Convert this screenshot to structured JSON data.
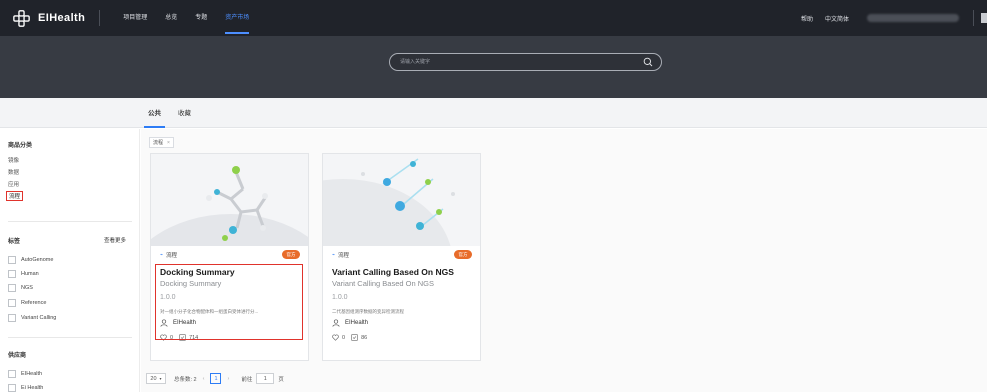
{
  "brand": {
    "name": "EIHealth"
  },
  "topnav": {
    "items": [
      {
        "label": "项目管理"
      },
      {
        "label": "总览"
      },
      {
        "label": "专题"
      },
      {
        "label": "资产市场",
        "active": true
      }
    ],
    "right": {
      "help": "帮助",
      "language": "中文简体"
    }
  },
  "search": {
    "placeholder": "请输入关键字",
    "icon": "search-icon"
  },
  "tabs": [
    {
      "label": "公共",
      "active": true
    },
    {
      "label": "收藏"
    }
  ],
  "sidebar": {
    "category_title": "商品分类",
    "categories": [
      {
        "label": "镜像"
      },
      {
        "label": "数据"
      },
      {
        "label": "应用"
      },
      {
        "label": "流程",
        "selected": true
      }
    ],
    "tags_title": "标签",
    "view_more": "查看更多",
    "tags": [
      "AutoGenome",
      "Human",
      "NGS",
      "Reference",
      "Variant Calling"
    ],
    "providers_title": "供应商",
    "providers": [
      "EIHealth",
      "Ei Health"
    ]
  },
  "filter": {
    "tag": "流程",
    "close": "×"
  },
  "cards": [
    {
      "type": "流程",
      "badge": "官方",
      "name": "Docking Summary",
      "subtitle": "Docking Summary",
      "version": "1.0.0",
      "description": "对一组小分子化合物配体和一组蛋白受体进行分...",
      "provider": "EIHealth",
      "likes": "0",
      "usage": "714"
    },
    {
      "type": "流程",
      "badge": "官方",
      "name": "Variant Calling Based On NGS",
      "subtitle": "Variant Calling Based On NGS",
      "version": "1.0.0",
      "description": "二代基因组测序数据的变异检测流程",
      "provider": "EIHealth",
      "likes": "0",
      "usage": "86"
    }
  ],
  "pager": {
    "page_size": "20",
    "total": "总条数: 2",
    "current": "1",
    "goto_prefix": "前往",
    "goto_value": "1",
    "goto_suffix": "页"
  },
  "colors": {
    "nav_bg": "#20232a",
    "accent": "#2d7cf5",
    "badge": "#e86c2a",
    "highlight": "#e0332c"
  }
}
